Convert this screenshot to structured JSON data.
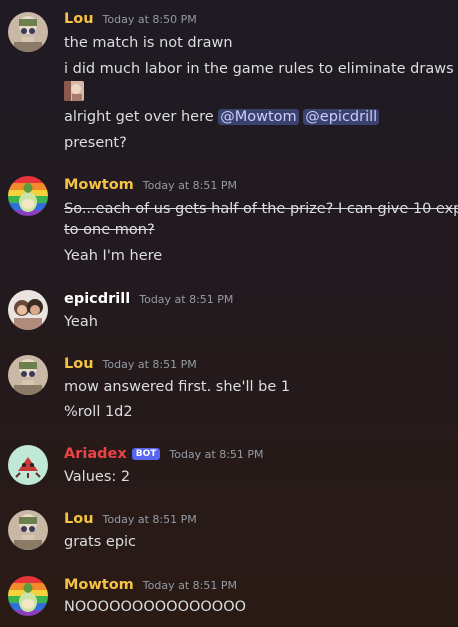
{
  "colors": {
    "lou": "#f5c242",
    "mowtom": "#f5c242",
    "epicdrill": "#ffffff",
    "ariadex": "#ed4245",
    "mention_bg": "#3c4270"
  },
  "messages": [
    {
      "author": "Lou",
      "time": "Today at 8:50 PM",
      "lines": [
        "the match is not drawn",
        "i did much labor in the game rules to eliminate draws"
      ],
      "mention_line": {
        "text": "alright get over here",
        "mentions": [
          "@Mowtom",
          "@epicdrill"
        ]
      },
      "last_line": "present?"
    },
    {
      "author": "Mowtom",
      "time": "Today at 8:51 PM",
      "strike1": "So...each of us gets half of the prize?  I can give 10 exp",
      "strike2": "to one mon?",
      "line": "Yeah I'm here"
    },
    {
      "author": "epicdrill",
      "time": "Today at 8:51 PM",
      "line": "Yeah"
    },
    {
      "author": "Lou",
      "time": "Today at 8:51 PM",
      "lines": [
        "mow answered first. she'll be 1",
        "%roll 1d2"
      ]
    },
    {
      "author": "Ariadex",
      "badge": "BOT",
      "time": "Today at 8:51 PM",
      "line": "Values: 2"
    },
    {
      "author": "Lou",
      "time": "Today at 8:51 PM",
      "line": "grats epic"
    },
    {
      "author": "Mowtom",
      "time": "Today at 8:51 PM",
      "line": "NOOOOOOOOOOOOOOO"
    }
  ]
}
